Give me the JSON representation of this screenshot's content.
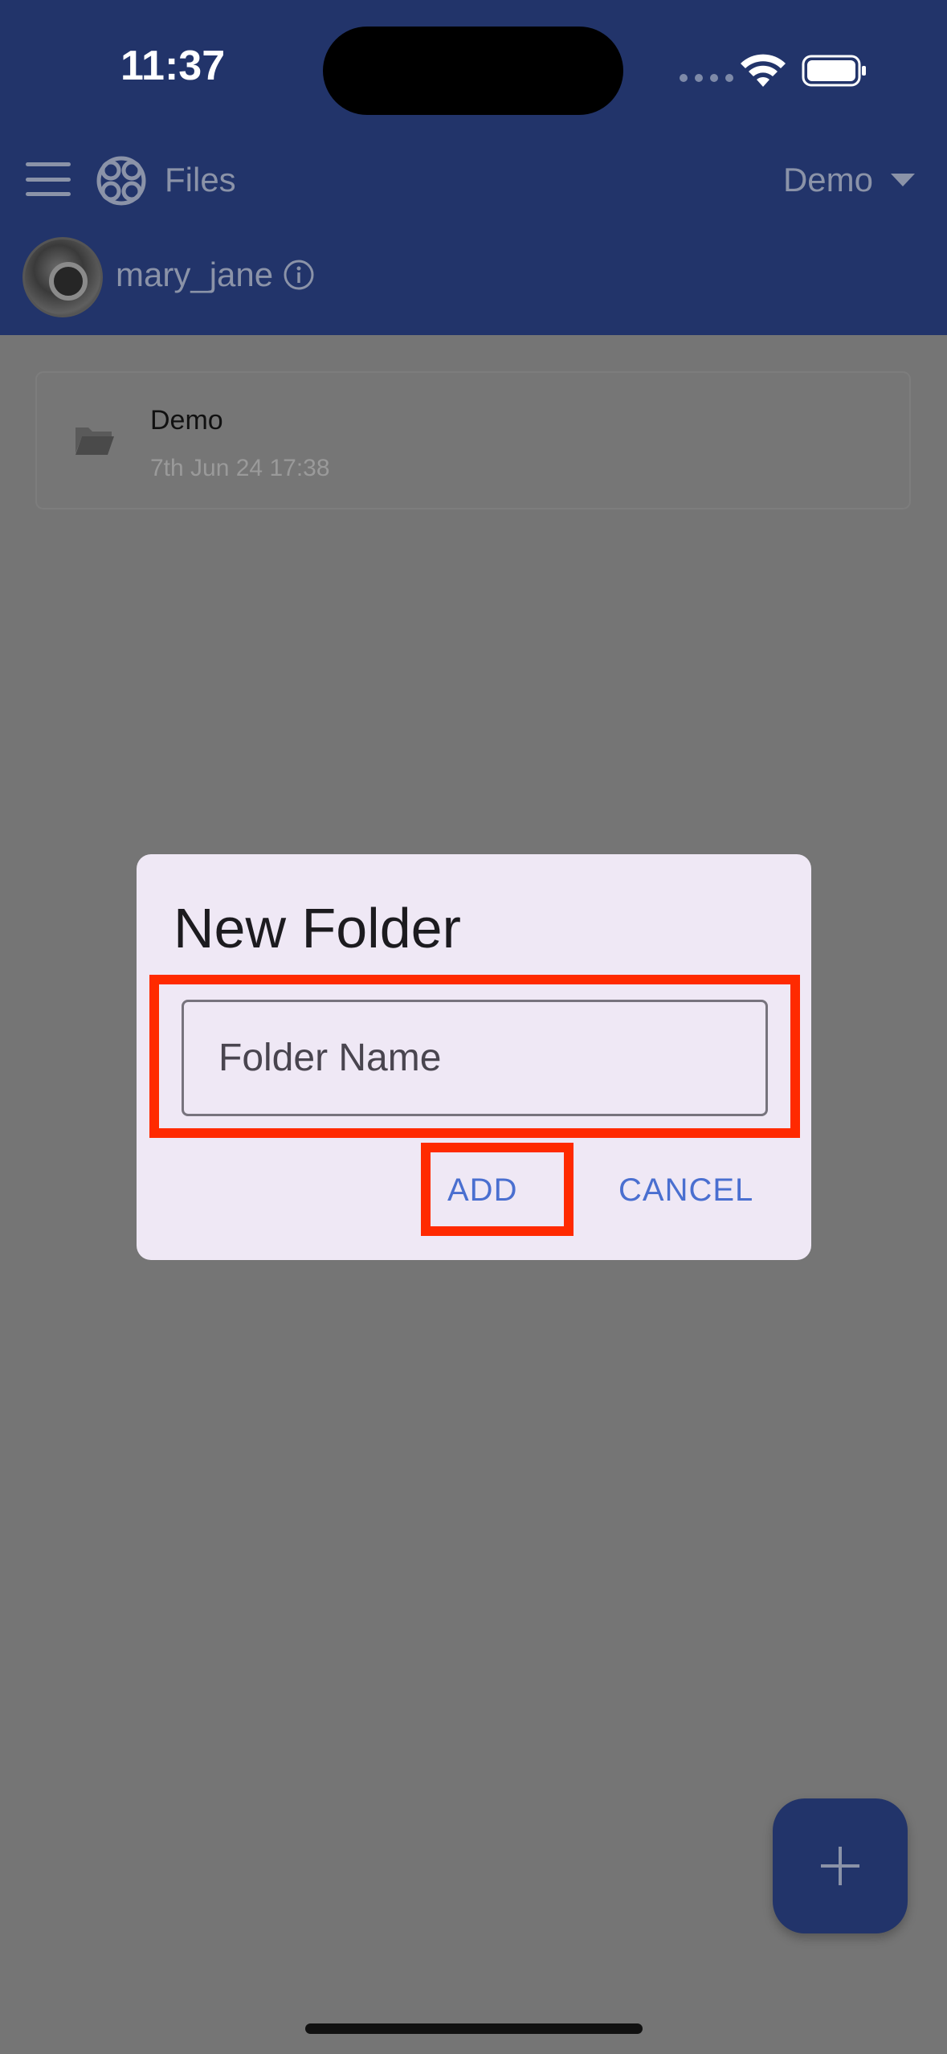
{
  "status_bar": {
    "time": "11:37"
  },
  "header": {
    "app_title": "Files",
    "workspace": "Demo",
    "username": "mary_jane"
  },
  "files": [
    {
      "name": "Demo",
      "date": "7th Jun 24 17:38",
      "icon": "folder-icon"
    }
  ],
  "dialog": {
    "title": "New Folder",
    "input_placeholder": "Folder Name",
    "input_value": "",
    "add_label": "ADD",
    "cancel_label": "CANCEL"
  },
  "colors": {
    "header": "#22346a",
    "dialog": "#efe8f5",
    "accent": "#4a6fd0",
    "highlight": "#ff2a00",
    "overlay": "#757575"
  }
}
